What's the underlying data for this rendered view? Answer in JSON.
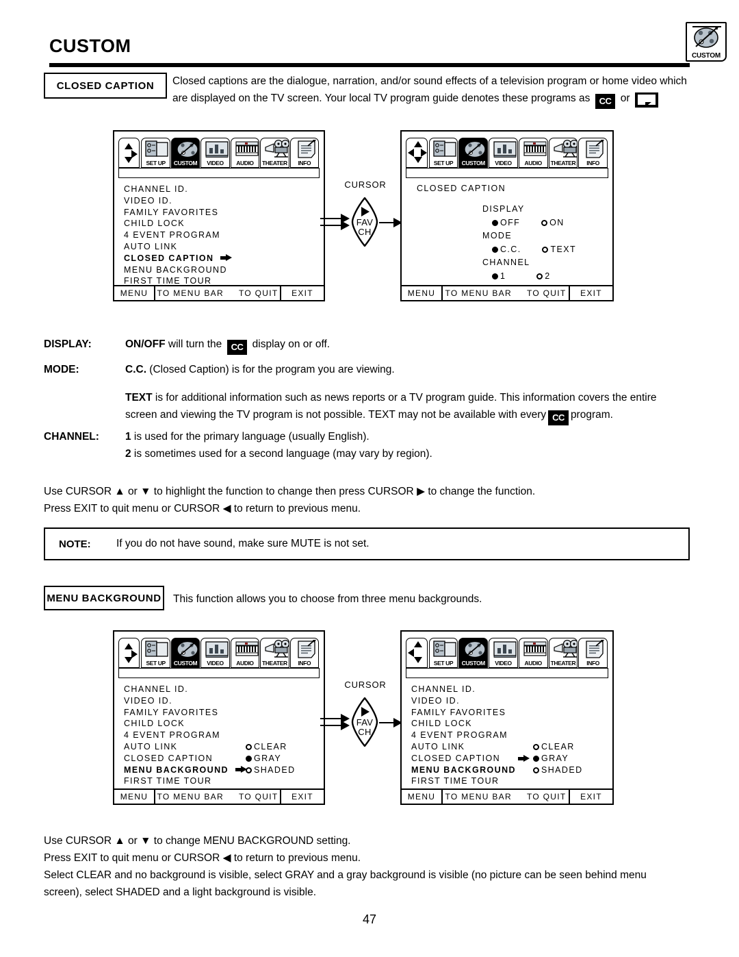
{
  "header": {
    "title": "CUSTOM",
    "corner_icon_label": "CUSTOM",
    "corner_icon_name": "palette-icon"
  },
  "closed_caption_section": {
    "label": "CLOSED CAPTION",
    "intro_line1_a": "Closed captions are the dialogue, narration, and/or sound effects of a television program or home video which",
    "intro_line2_a": "are displayed on the TV screen.  Your local TV program guide denotes these programs as",
    "cc_chip": "CC",
    "intro_or": "or",
    "intro_end": "."
  },
  "menubar": {
    "items": [
      {
        "label": "SET UP",
        "icon": "setup-icon",
        "selected": false
      },
      {
        "label": "CUSTOM",
        "icon": "palette-icon",
        "selected": true
      },
      {
        "label": "VIDEO",
        "icon": "video-icon",
        "selected": false
      },
      {
        "label": "AUDIO",
        "icon": "audio-icon",
        "selected": false
      },
      {
        "label": "THEATER",
        "icon": "theater-icon",
        "selected": false
      },
      {
        "label": "INFO",
        "icon": "info-icon",
        "selected": false
      }
    ]
  },
  "custom_menu_items": [
    "CHANNEL ID.",
    "VIDEO ID.",
    "FAMILY FAVORITES",
    "CHILD LOCK",
    "4 EVENT PROGRAM",
    "AUTO LINK",
    "CLOSED CAPTION",
    "MENU BACKGROUND",
    "FIRST TIME TOUR"
  ],
  "tv_footer": {
    "menu": "MENU",
    "to_menu_bar": "TO MENU BAR",
    "to_quit": "TO QUIT",
    "exit": "EXIT"
  },
  "cursor_connector": {
    "label": "CURSOR",
    "fav": "FAV",
    "ch": "CH"
  },
  "cc_detail_screen": {
    "title": "CLOSED CAPTION",
    "groups": [
      {
        "title": "DISPLAY",
        "options": [
          {
            "label": "OFF",
            "selected": true
          },
          {
            "label": "ON",
            "selected": false
          }
        ],
        "pointer": true
      },
      {
        "title": "MODE",
        "options": [
          {
            "label": "C.C.",
            "selected": true
          },
          {
            "label": "TEXT",
            "selected": false
          }
        ],
        "pointer": false
      },
      {
        "title": "CHANNEL",
        "options": [
          {
            "label": "1",
            "selected": true
          },
          {
            "label": "2",
            "selected": false
          }
        ],
        "pointer": false
      }
    ]
  },
  "definitions": [
    {
      "term": "DISPLAY:",
      "lines": [
        {
          "bold_lead": "ON/OFF",
          "text_a": " will turn the ",
          "chip": "CC",
          "text_b": " display on or off."
        }
      ]
    },
    {
      "term": "MODE:",
      "lines": [
        {
          "bold_lead": "C.C.",
          "text_a": " (Closed Caption) is for the program you are viewing.",
          "chip": "",
          "text_b": ""
        }
      ]
    }
  ],
  "text_paragraph": {
    "bold_lead": "TEXT",
    "line1": " is for additional information such as news reports or a TV program guide.  This information covers the entire",
    "line2_a": "screen and viewing the TV program is not possible.  TEXT may not be available with every",
    "chip": "CC",
    "line2_b": "program."
  },
  "channel_def": {
    "term": "CHANNEL:",
    "line1_bold": "1",
    "line1": " is used for the primary language (usually English).",
    "line2_bold": "2",
    "line2": " is sometimes used for a second language (may vary by region)."
  },
  "cc_instructions": {
    "line1_a": "Use CURSOR",
    "line1_b": "or",
    "line1_c": "to highlight the function to change then press CURSOR",
    "line1_d": "to change the function.",
    "line2_a": "Press EXIT to quit menu or CURSOR",
    "line2_b": "to return to previous menu."
  },
  "note": {
    "label": "NOTE:",
    "text": "If you do not have sound, make sure MUTE is not set."
  },
  "menu_background_section": {
    "label": "MENU BACKGROUND",
    "intro": "This function allows you to choose from three menu backgrounds.",
    "options": [
      {
        "label": "CLEAR",
        "selected": false
      },
      {
        "label": "GRAY",
        "selected": true
      },
      {
        "label": "SHADED",
        "selected": false
      }
    ],
    "highlight_left": "MENU BACKGROUND",
    "highlight_right": "MENU BACKGROUND"
  },
  "mb_instructions": {
    "line1_a": "Use CURSOR",
    "line1_b": "or",
    "line1_c": "to change MENU BACKGROUND setting.",
    "line2_a": "Press EXIT to quit menu or CURSOR",
    "line2_b": "to return to previous menu.",
    "line3": "Select CLEAR and no background is visible, select GRAY and a gray background is visible (no picture can be seen behind menu",
    "line4": "screen), select SHADED and a light background is visible."
  },
  "page_number": "47",
  "colors": {
    "ink": "#000000",
    "paper": "#ffffff",
    "icon_gray": "#b9c3cc",
    "icon_gray_dark": "#7a858f"
  }
}
